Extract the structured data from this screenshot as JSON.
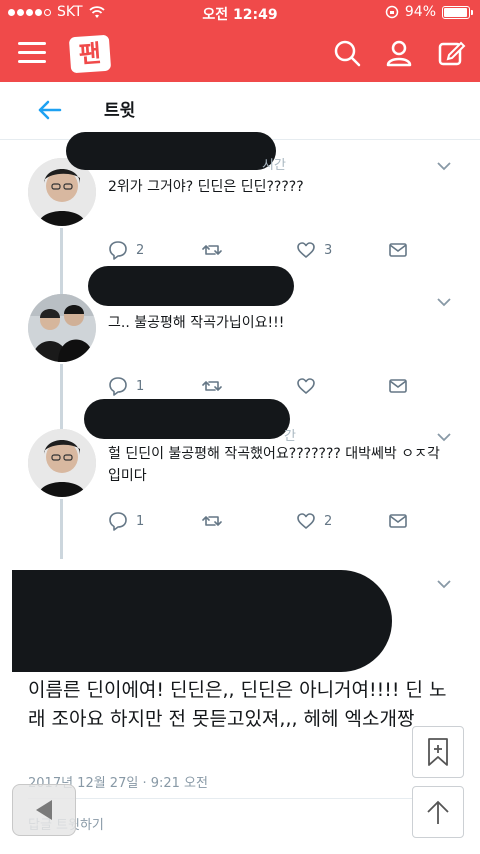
{
  "status_bar": {
    "carrier": "SKT",
    "time": "오전 12:49",
    "battery": "94%",
    "battery_level": 0.94
  },
  "app": {
    "logo": "팬"
  },
  "detail_header": {
    "title": "트윗"
  },
  "tweets": [
    {
      "meta_hint": "시간",
      "text": "2위가 그거야? 딘딘은 딘딘?????",
      "reply_count": "2",
      "retweet_count": "",
      "like_count": "3"
    },
    {
      "meta_hint": "",
      "text": "그.. 불공평해 작곡가닙이요!!!",
      "reply_count": "1",
      "retweet_count": "",
      "like_count": ""
    },
    {
      "meta_hint": "간",
      "text": "헐 딘딘이 불공평해 작곡했어요??????? 대박쎄박 ㅇㅈ각입미다",
      "reply_count": "1",
      "retweet_count": "",
      "like_count": "2"
    }
  ],
  "main_tweet": {
    "text": "이름른 딘이에여! 딘딘은,, 딘딘은 아니거여!!!! 딘 노래 조아요 하지만 전 못듣고있져,,, 헤헤 엑소개짱",
    "timestamp": "2017년 12월 27일 · 9:21 오전",
    "reply_label": "답글 트윗하기"
  },
  "icons": {
    "menu": "menu-icon",
    "search": "search-icon",
    "profile": "user-icon",
    "compose": "compose-icon",
    "back": "back-arrow-icon",
    "chevron": "chevron-down-icon",
    "reply": "reply-icon",
    "retweet": "retweet-icon",
    "like": "heart-icon",
    "dm": "mail-icon",
    "bookmark": "bookmark-add-icon",
    "scroll_top": "arrow-up-icon",
    "browser_back": "browser-back-icon"
  },
  "colors": {
    "brand": "#f04a4a",
    "accent": "#1da1f2",
    "icon_gray": "#657786"
  }
}
